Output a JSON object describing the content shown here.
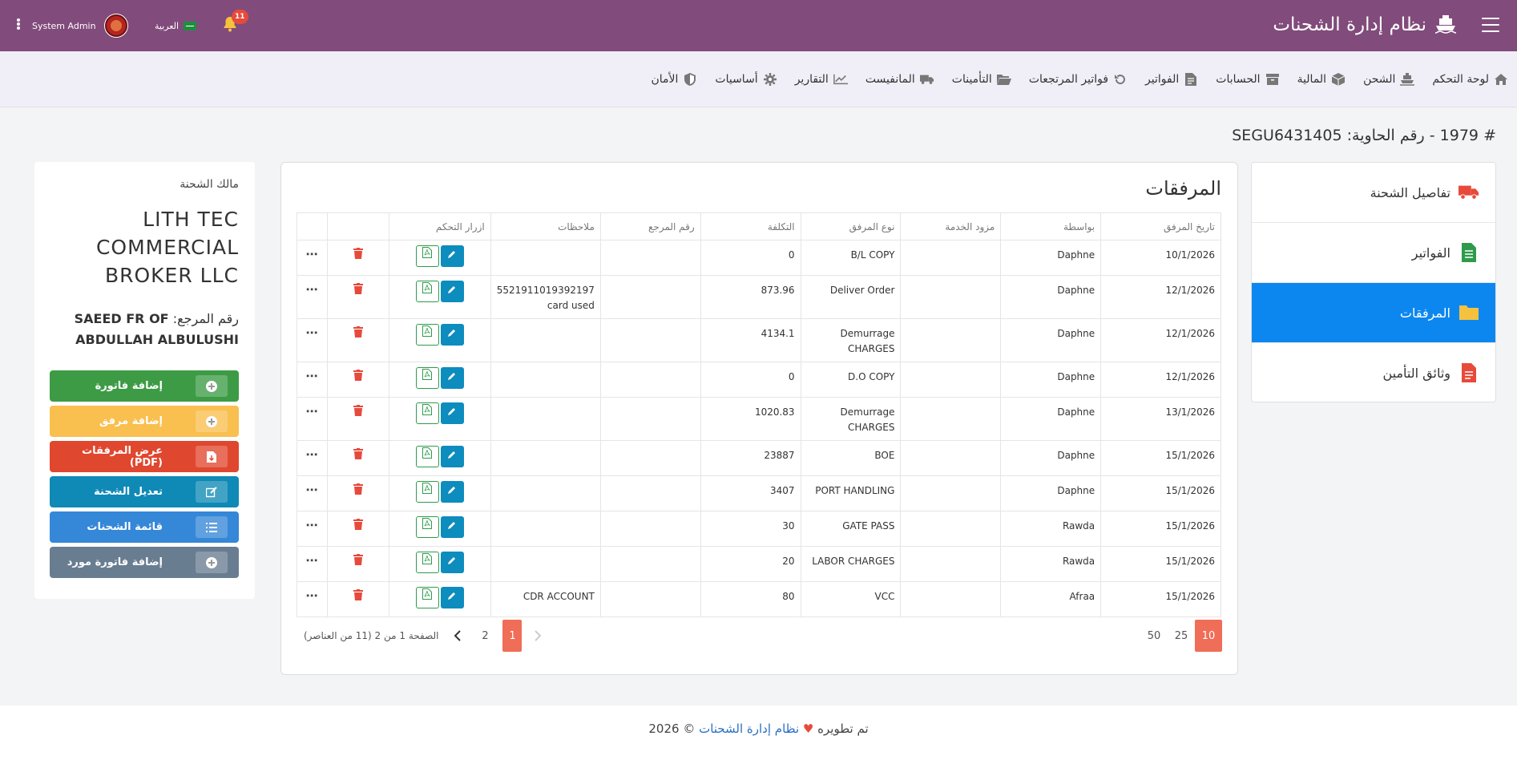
{
  "header": {
    "app_title": "نظام إدارة الشحنات",
    "user_name": "System Admin",
    "language": "العربية",
    "notification_count": "11"
  },
  "nav": {
    "items": [
      {
        "label": "لوحة التحكم",
        "icon": "home-icon"
      },
      {
        "label": "الشحن",
        "icon": "ship-icon"
      },
      {
        "label": "المالية",
        "icon": "box-icon"
      },
      {
        "label": "الحسابات",
        "icon": "archive-icon"
      },
      {
        "label": "الفواتير",
        "icon": "invoice-icon"
      },
      {
        "label": "فواتير المرتجعات",
        "icon": "undo-icon"
      },
      {
        "label": "التأمينات",
        "icon": "folder-open-icon"
      },
      {
        "label": "المانفيست",
        "icon": "truck-icon"
      },
      {
        "label": "التقارير",
        "icon": "chart-icon"
      },
      {
        "label": "أساسيات",
        "icon": "gear-icon"
      },
      {
        "label": "الأمان",
        "icon": "shield-icon"
      }
    ]
  },
  "page": {
    "heading": "# 1979 - رقم الحاوية: SEGU6431405"
  },
  "side_tabs": [
    {
      "label": "تفاصيل الشحنة",
      "icon": "truck-icon",
      "color": "#e74a3b",
      "active": false
    },
    {
      "label": "الفواتير",
      "icon": "invoice-icon",
      "color": "#2e9b4c",
      "active": false
    },
    {
      "label": "المرفقات",
      "icon": "folder-icon",
      "color": "#f6c23e",
      "active": true
    },
    {
      "label": "وثائق التأمين",
      "icon": "document-icon",
      "color": "#e74a3b",
      "active": false
    }
  ],
  "attachments": {
    "title": "المرفقات",
    "columns": [
      "تاريخ المرفق",
      "بواسطة",
      "مزود الخدمة",
      "نوع المرفق",
      "التكلفة",
      "رقم المرجع",
      "ملاحظات",
      "ازرار التحكم",
      "",
      ""
    ],
    "rows": [
      {
        "date": "10/1/2026",
        "by": "Daphne",
        "provider": "",
        "type": "B/L COPY",
        "cost": "0",
        "ref": "",
        "notes": ""
      },
      {
        "date": "12/1/2026",
        "by": "Daphne",
        "provider": "",
        "type": "Deliver Order",
        "cost": "873.96",
        "ref": "",
        "notes": "5521911019392197 card used"
      },
      {
        "date": "12/1/2026",
        "by": "Daphne",
        "provider": "",
        "type": "Demurrage CHARGES",
        "cost": "4134.1",
        "ref": "",
        "notes": ""
      },
      {
        "date": "12/1/2026",
        "by": "Daphne",
        "provider": "",
        "type": "D.O COPY",
        "cost": "0",
        "ref": "",
        "notes": ""
      },
      {
        "date": "13/1/2026",
        "by": "Daphne",
        "provider": "",
        "type": "Demurrage CHARGES",
        "cost": "1020.83",
        "ref": "",
        "notes": ""
      },
      {
        "date": "15/1/2026",
        "by": "Daphne",
        "provider": "",
        "type": "BOE",
        "cost": "23887",
        "ref": "",
        "notes": ""
      },
      {
        "date": "15/1/2026",
        "by": "Daphne",
        "provider": "",
        "type": "PORT HANDLING",
        "cost": "3407",
        "ref": "",
        "notes": ""
      },
      {
        "date": "15/1/2026",
        "by": "Rawda",
        "provider": "",
        "type": "GATE PASS",
        "cost": "30",
        "ref": "",
        "notes": ""
      },
      {
        "date": "15/1/2026",
        "by": "Rawda",
        "provider": "",
        "type": "LABOR CHARGES",
        "cost": "20",
        "ref": "",
        "notes": ""
      },
      {
        "date": "15/1/2026",
        "by": "Afraa",
        "provider": "",
        "type": "VCC",
        "cost": "80",
        "ref": "",
        "notes": "CDR ACCOUNT"
      }
    ],
    "pagination": {
      "info": "الصفحة 1 من 2 (11 من العناصر)",
      "pages": [
        "1",
        "2"
      ],
      "current_page": "1",
      "page_sizes": [
        "10",
        "25",
        "50"
      ],
      "current_size": "10"
    }
  },
  "owner": {
    "label": "مالك الشحنة",
    "name": "LITH TEC COMMERCIAL BROKER LLC",
    "ref_label": "رقم المرجع:",
    "ref_value": "SAEED FR OF ABDULLAH ALBULUSHI"
  },
  "actions": [
    {
      "label": "إضافة فاتورة",
      "icon": "plus-circle-icon",
      "color": "#3d9b46"
    },
    {
      "label": "إضافة مرفق",
      "icon": "plus-circle-icon",
      "color": "#f9bf4f"
    },
    {
      "label": "عرض المرفقات (PDF)",
      "icon": "file-download-icon",
      "color": "#e0472f"
    },
    {
      "label": "تعديل الشحنة",
      "icon": "edit-icon",
      "color": "#0f89b5"
    },
    {
      "label": "قائمة الشحنات",
      "icon": "list-icon",
      "color": "#3587d8"
    },
    {
      "label": "إضافة فاتورة مورد",
      "icon": "plus-circle-icon",
      "color": "#697d91"
    }
  ],
  "footer": {
    "prefix": "تم تطويره",
    "link": "نظام إدارة الشحنات",
    "suffix": "© 2026"
  }
}
